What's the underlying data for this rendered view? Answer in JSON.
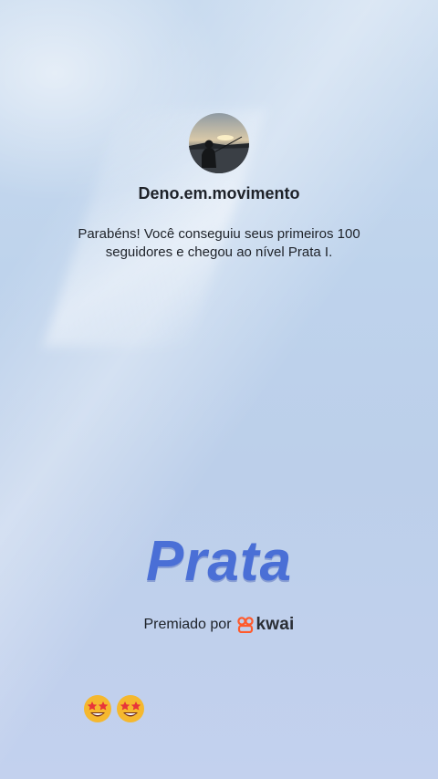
{
  "profile": {
    "username": "Deno.em.movimento",
    "avatar_icon": "fisherman-sunset-avatar"
  },
  "message": {
    "text": "Parabéns! Você conseguiu seus primeiros 100 seguidores e chegou ao nível Prata I."
  },
  "level": {
    "name": "Prata"
  },
  "footer": {
    "premiado_label": "Premiado por",
    "brand_name": "kwai",
    "brand_icon": "kwai-logo-icon",
    "brand_color": "#ff5a2c"
  },
  "reaction": {
    "emoji_icon": "star-struck-emoji",
    "count_shown": 2
  },
  "colors": {
    "background_top": "#c9dbef",
    "background_bottom": "#c3d1ee",
    "level_text": "#4a6fd6"
  }
}
